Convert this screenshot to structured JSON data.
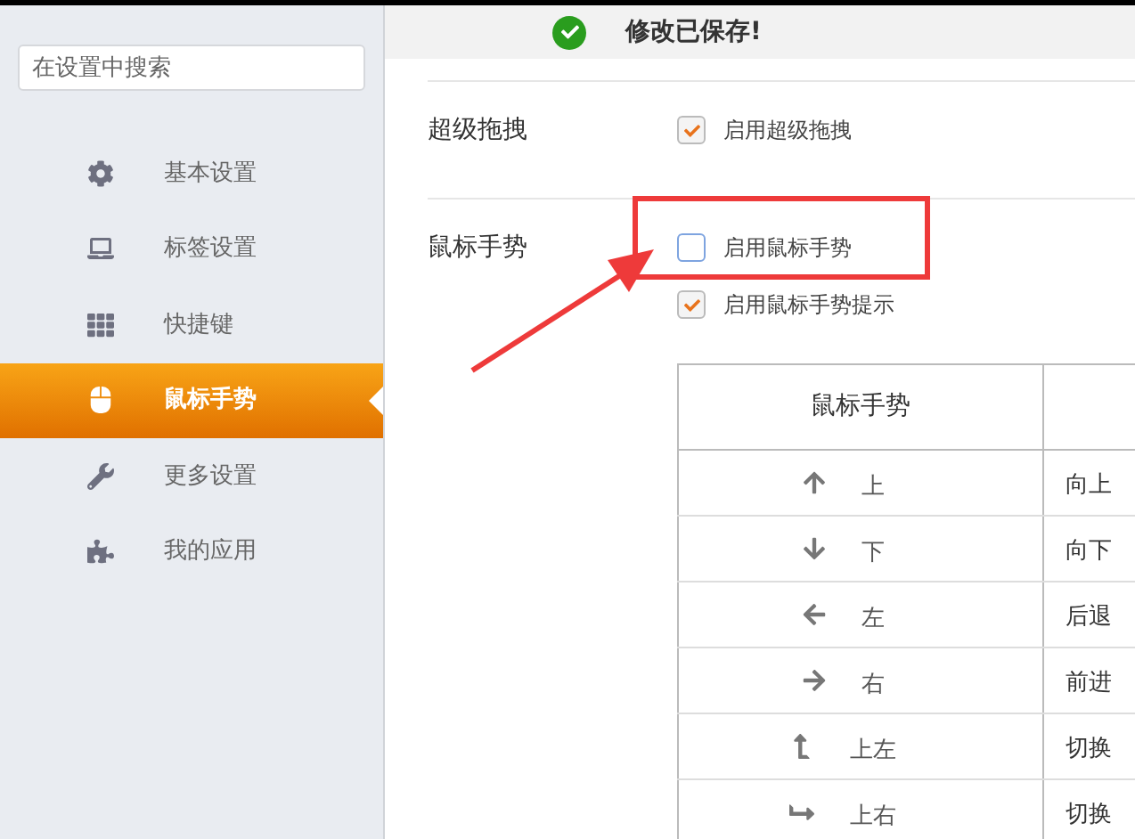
{
  "sidebar": {
    "search": {
      "placeholder": "在设置中搜索"
    },
    "items": [
      {
        "kind": "gear",
        "label": "基本设置",
        "selected": false
      },
      {
        "kind": "laptop",
        "label": "标签设置",
        "selected": false
      },
      {
        "kind": "keyboard",
        "label": "快捷键",
        "selected": false
      },
      {
        "kind": "mouse",
        "label": "鼠标手势",
        "selected": true
      },
      {
        "kind": "wrench",
        "label": "更多设置",
        "selected": false
      },
      {
        "kind": "puzzle",
        "label": "我的应用",
        "selected": false
      }
    ]
  },
  "toast": {
    "message": "修改已保存!"
  },
  "sections": [
    {
      "title": "超级拖拽",
      "options": [
        {
          "label": "启用超级拖拽",
          "checked": true,
          "highlighted": false
        }
      ]
    },
    {
      "title": "鼠标手势",
      "options": [
        {
          "label": "启用鼠标手势",
          "checked": false,
          "highlighted": true
        },
        {
          "label": "启用鼠标手势提示",
          "checked": true,
          "highlighted": false
        }
      ]
    }
  ],
  "gesture_table": {
    "columns": [
      "鼠标手势"
    ],
    "rows": [
      {
        "kind": "up",
        "gesture": "上",
        "action": "向上"
      },
      {
        "kind": "down",
        "gesture": "下",
        "action": "向下"
      },
      {
        "kind": "left",
        "gesture": "左",
        "action": "后退"
      },
      {
        "kind": "right",
        "gesture": "右",
        "action": "前进"
      },
      {
        "kind": "up-left",
        "gesture": "上左",
        "action": "切换"
      },
      {
        "kind": "up-right",
        "gesture": "上右",
        "action": "切换"
      }
    ]
  }
}
